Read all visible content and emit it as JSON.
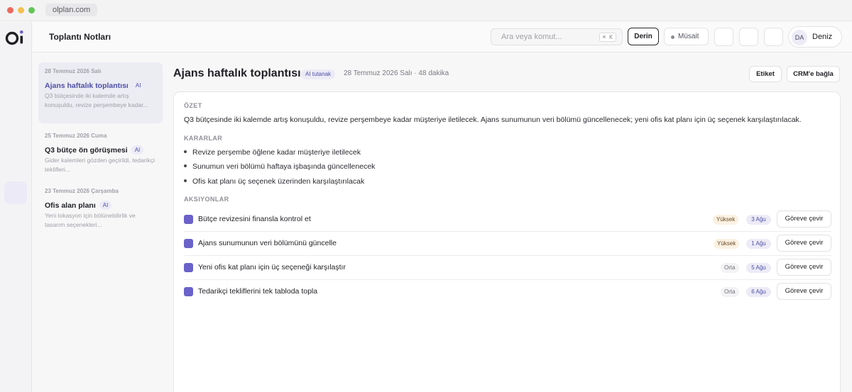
{
  "browser": {
    "url": "olplan.com"
  },
  "header": {
    "title": "Toplantı Notları",
    "search_placeholder": "Ara veya komut...",
    "search_shortcut": "⌘ K",
    "mode_button": "Derin",
    "status": "Müsait",
    "user_initials": "DA",
    "user_name": "Deniz"
  },
  "meetings": [
    {
      "date": "28 Temmuz 2026 Salı",
      "title": "Ajans haftalık toplantısı",
      "tag": "AI",
      "snippet": "Q3 bütçesinde iki kalemde artış konuşuldu, revize perşembeye kadar..."
    },
    {
      "date": "25 Temmuz 2026 Cuma",
      "title": "Q3 bütçe ön görüşmesi",
      "tag": "AI",
      "snippet": "Gider kalemleri gözden geçirildi, tedarikçi teklifleri..."
    },
    {
      "date": "23 Temmuz 2026 Çarşamba",
      "title": "Ofis alan planı",
      "tag": "AI",
      "snippet": "Yeni lokasyon için bölünebilirlik ve tasarım seçenekleri..."
    }
  ],
  "detail": {
    "title": "Ajans haftalık toplantısı",
    "ai_chip": "AI tutanak",
    "meta": "28 Temmuz 2026 Salı · 48 dakika",
    "tag_button": "Etiket",
    "crm_button": "CRM'e bağla",
    "summary_label": "ÖZET",
    "summary": "Q3 bütçesinde iki kalemde artış konuşuldu, revize perşembeye kadar müşteriye iletilecek. Ajans sunumunun veri bölümü güncellenecek; yeni ofis kat planı için üç seçenek karşılaştırılacak.",
    "decisions_label": "KARARLAR",
    "decisions": [
      "Revize perşembe öğlene kadar müşteriye iletilecek",
      "Sunumun veri bölümü haftaya işbaşında güncellenecek",
      "Ofis kat planı üç seçenek üzerinden karşılaştırılacak"
    ],
    "actions_label": "AKSIYONLAR",
    "actions": [
      {
        "text": "Bütçe revizesini finansla kontrol et",
        "priority": "Yüksek",
        "due": "3 Ağu",
        "button": "Göreve çevir"
      },
      {
        "text": "Ajans sunumunun veri bölümünü güncelle",
        "priority": "Yüksek",
        "due": "1 Ağu",
        "button": "Göreve çevir"
      },
      {
        "text": "Yeni ofis kat planı için üç seçeneği karşılaştır",
        "priority": "Orta",
        "due": "5 Ağu",
        "button": "Göreve çevir"
      },
      {
        "text": "Tedarikçi tekliflerini tek tabloda topla",
        "priority": "Orta",
        "due": "6 Ağu",
        "button": "Göreve çevir"
      }
    ]
  },
  "colors": {
    "accent": "#4d4fa6",
    "checkbox": "#6a62c9",
    "priority_high_bg": "#fbf1e3",
    "window_close": "#ed6a5e",
    "window_min": "#f4bf4f",
    "window_max": "#61c554"
  }
}
